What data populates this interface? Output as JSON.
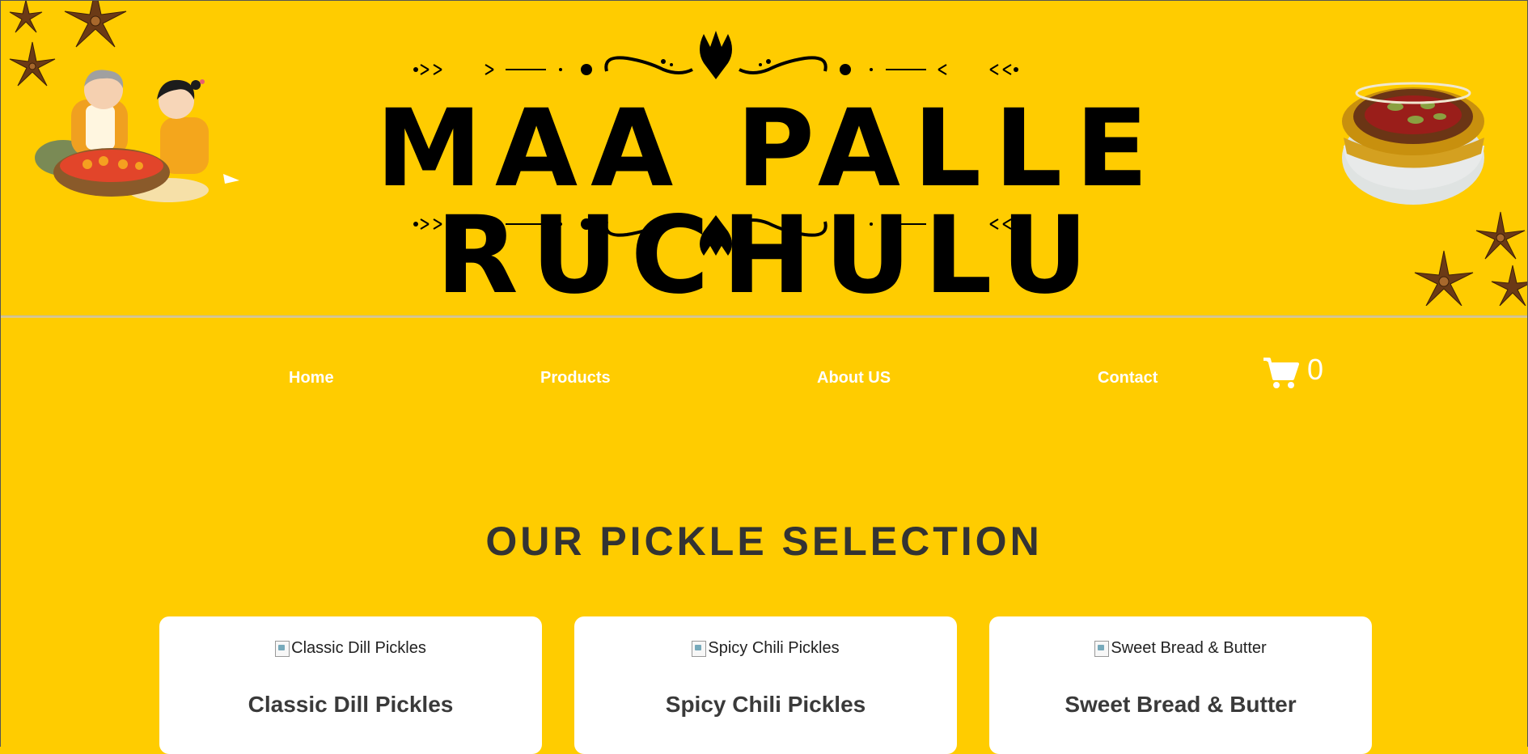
{
  "brand": {
    "title": "MAA PALLE RUCHULU"
  },
  "nav": {
    "items": [
      {
        "label": "Home"
      },
      {
        "label": "Products"
      },
      {
        "label": "About US"
      },
      {
        "label": "Contact"
      }
    ],
    "cart": {
      "icon": "cart-icon",
      "count": "0"
    }
  },
  "section": {
    "title": "OUR PICKLE SELECTION"
  },
  "products": [
    {
      "img_alt": "Classic Dill Pickles",
      "name": "Classic Dill Pickles"
    },
    {
      "img_alt": "Spicy Chili Pickles",
      "name": "Spicy Chili Pickles"
    },
    {
      "img_alt": "Sweet Bread & Butter",
      "name": "Sweet Bread & Butter"
    }
  ],
  "colors": {
    "background": "#ffcc00",
    "nav_text": "#ffffff",
    "heading": "#333333",
    "card": "#ffffff"
  }
}
